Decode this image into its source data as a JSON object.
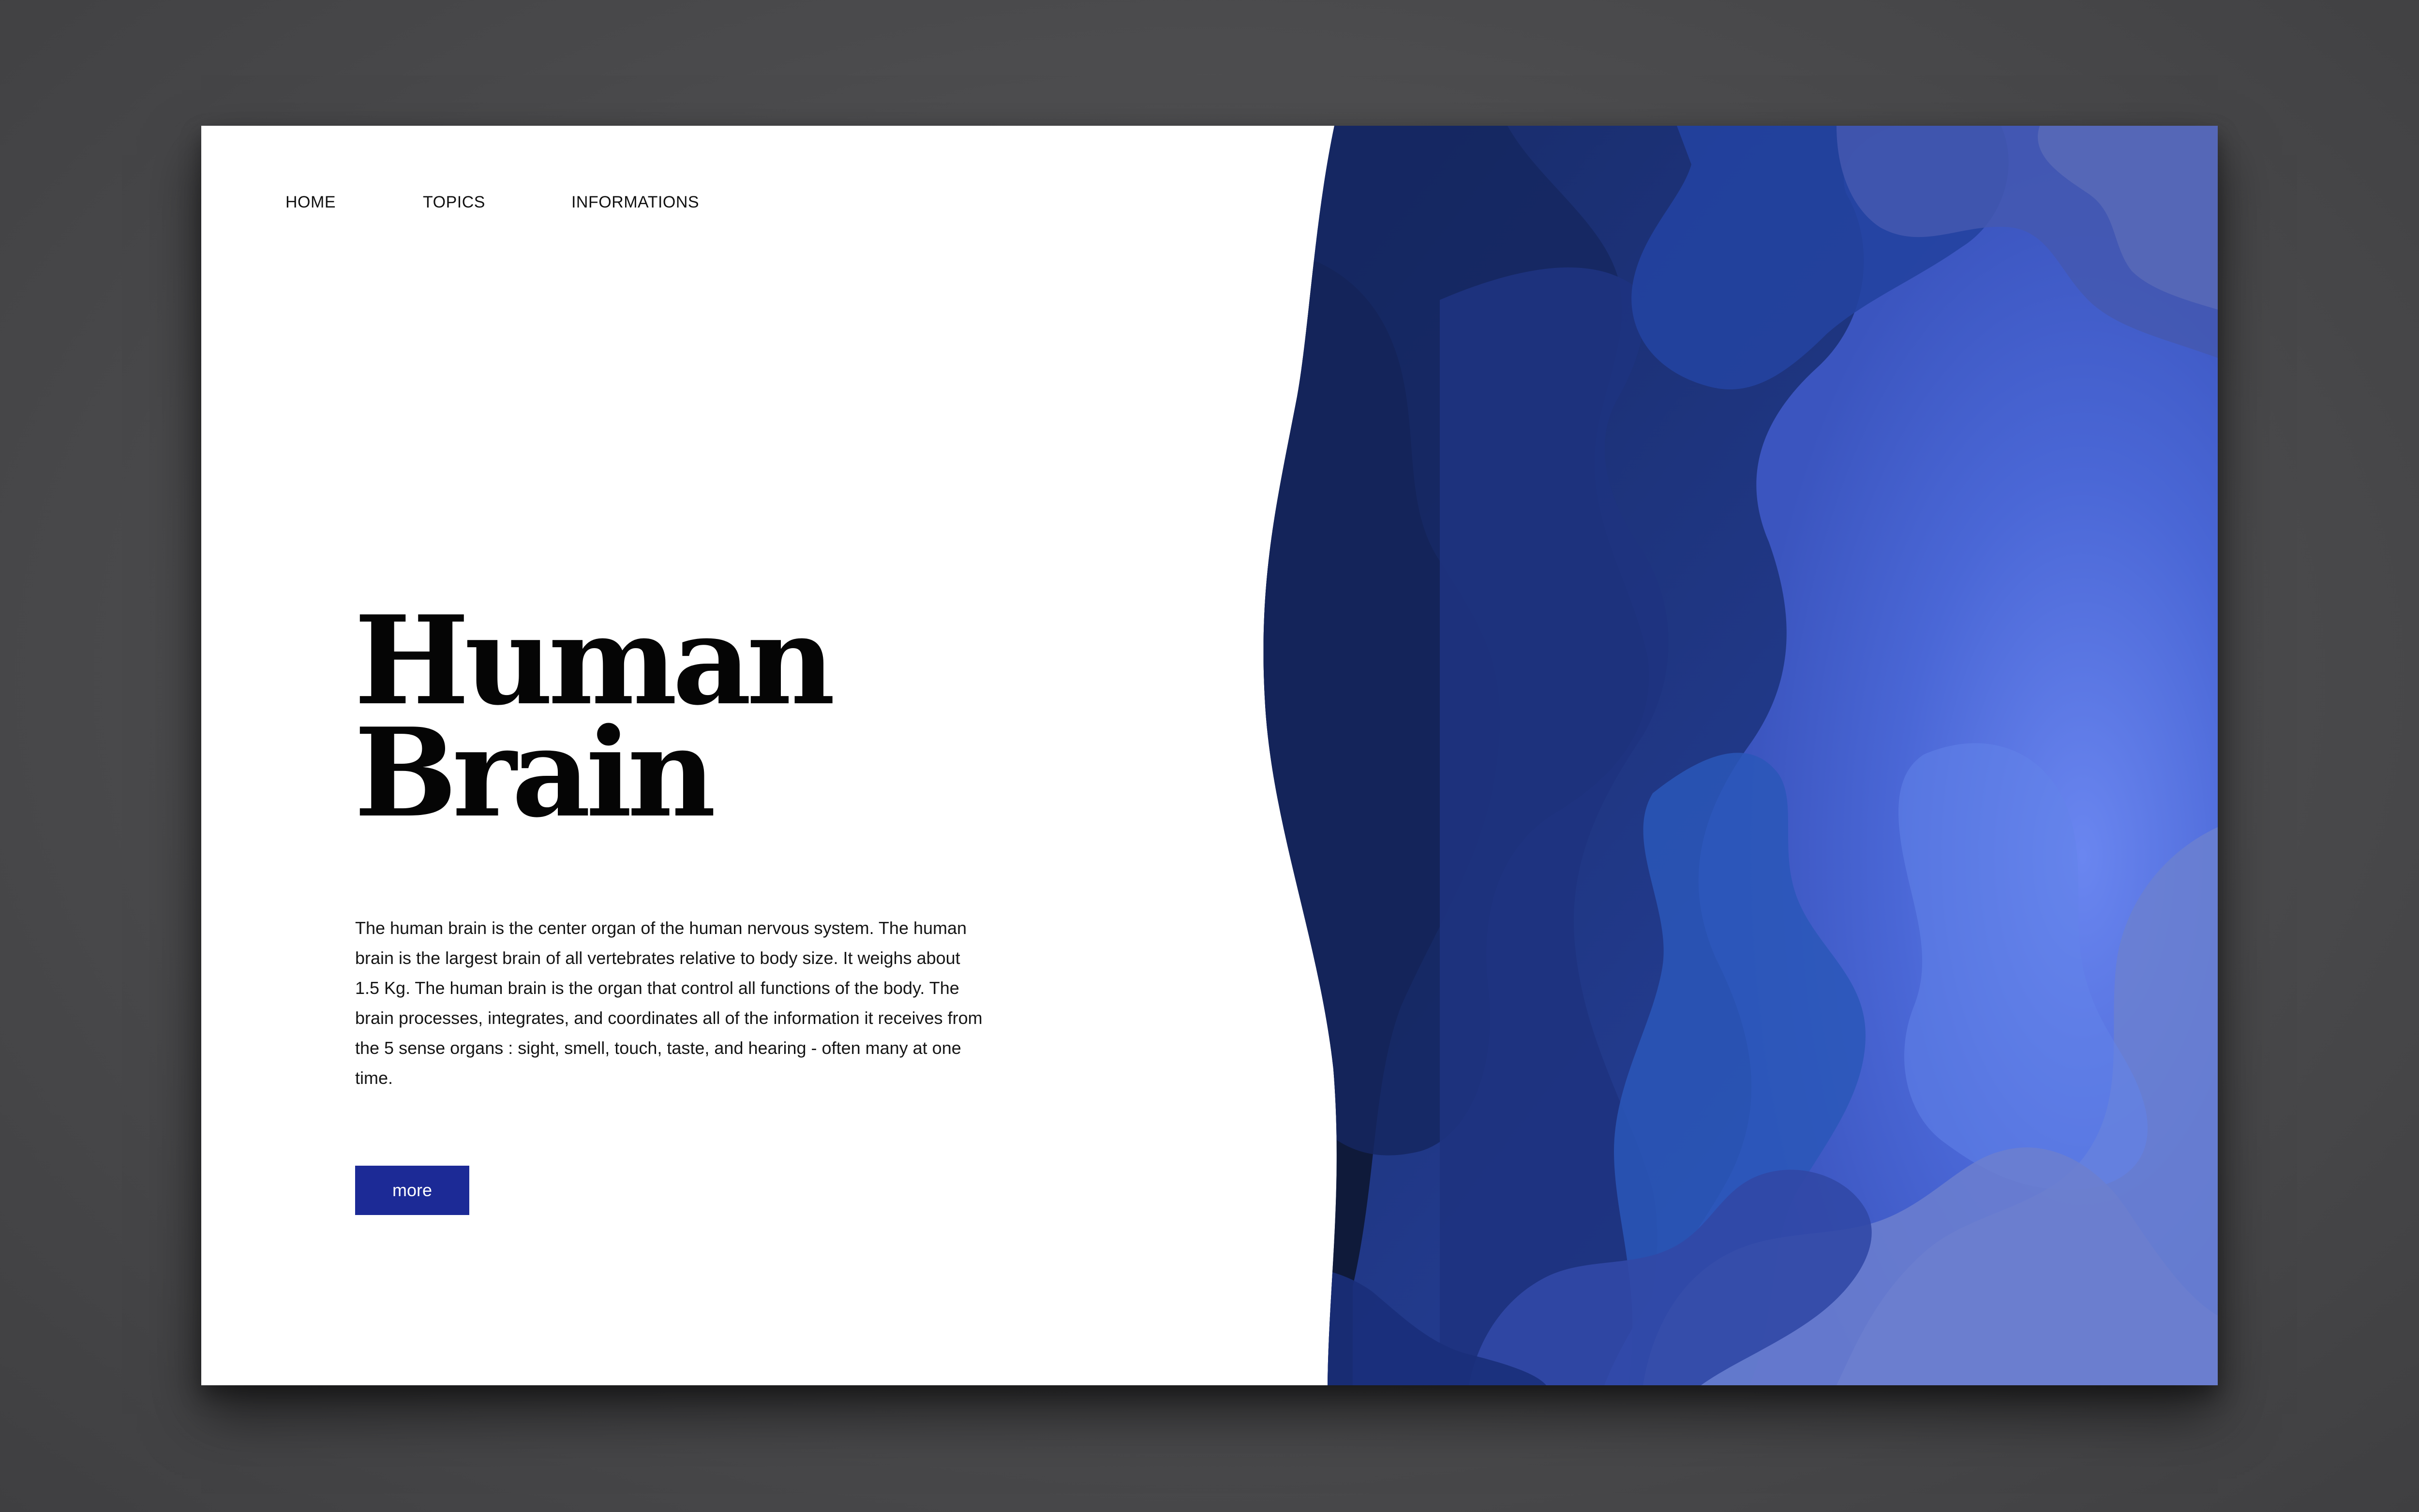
{
  "nav": {
    "items": [
      {
        "label": "HOME"
      },
      {
        "label": "TOPICS"
      },
      {
        "label": "INFORMATIONS"
      }
    ]
  },
  "hero": {
    "title_line1": "Human",
    "title_line2": "Brain",
    "description": "The human brain is the center organ of the human nervous system. The human brain is the largest brain of all vertebrates relative to body size. It weighs about 1.5 Kg. The human brain is the organ that control all functions of the body. The brain processes, integrates, and coordinates all of the information it receives from the 5 sense organs : sight, smell, touch, taste, and hearing - often many at one time.",
    "button_label": "more"
  },
  "colors": {
    "button": "#1c2a96",
    "wave_dark": "#0f1a3a",
    "wave_mid": "#23398f",
    "wave_light": "#5b78e0",
    "background": "#4d4d4f"
  }
}
